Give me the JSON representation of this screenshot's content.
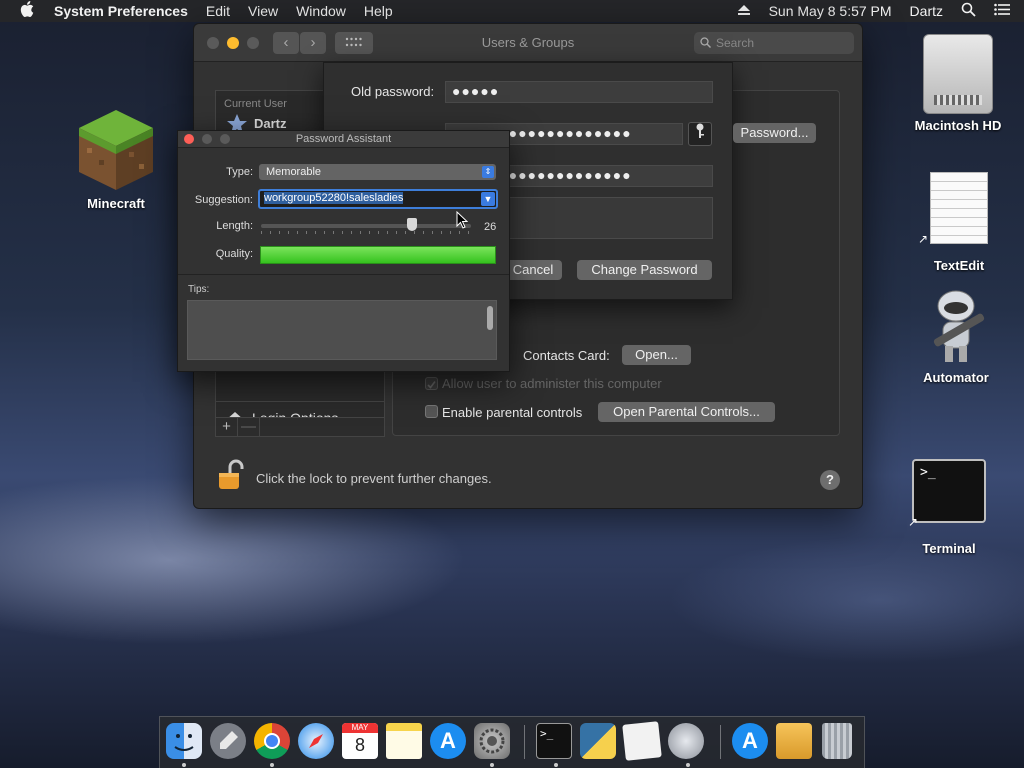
{
  "menubar": {
    "app_name": "System Preferences",
    "items": [
      "Edit",
      "View",
      "Window",
      "Help"
    ],
    "clock": "Sun May 8  5:57 PM",
    "user": "Dartz"
  },
  "desktop": {
    "minecraft": "Minecraft",
    "macintosh_hd": "Macintosh HD",
    "textedit": "TextEdit",
    "automator": "Automator",
    "terminal": "Terminal"
  },
  "window": {
    "title": "Users & Groups",
    "search_placeholder": "Search",
    "current_user_header": "Current User",
    "current_user_name": "Dartz",
    "login_options": "Login Options",
    "add_symbol": "+",
    "remove_symbol": "—",
    "contacts_card_label": "Contacts Card:",
    "open_button": "Open...",
    "allow_admin_label": "Allow user to administer this computer",
    "parental_controls_label": "Enable parental controls",
    "open_parental_button": "Open Parental Controls...",
    "lock_text": "Click the lock to prevent further changes.",
    "help_symbol": "?"
  },
  "sheet": {
    "old_password_label": "Old password:",
    "old_password_value": "●●●●●",
    "new_password_value": "●●●●●●●●●●●●●●●●●●●",
    "verify_value": "●●●●●●●●●●●●●●●●●●●",
    "password_button": "Password...",
    "cancel_button": "Cancel",
    "change_button": "Change Password"
  },
  "assistant": {
    "title": "Password Assistant",
    "type_label": "Type:",
    "type_value": "Memorable",
    "suggestion_label": "Suggestion:",
    "suggestion_value": "workgroup52280!salesladies",
    "length_label": "Length:",
    "length_value": "26",
    "length_fraction": 0.72,
    "quality_label": "Quality:",
    "quality_fraction": 1.0,
    "tips_label": "Tips:"
  },
  "dock": {
    "apps": [
      "finder-icon",
      "launchpad-icon",
      "chrome-icon",
      "safari-icon",
      "calendar-icon",
      "notes-icon",
      "app-store-icon",
      "system-preferences-icon",
      "terminal-icon",
      "python-launcher-icon",
      "script-editor-icon",
      "automator-icon",
      "app-store-folder-icon",
      "package-icon",
      "trash-icon"
    ],
    "calendar_month": "MAY",
    "calendar_day": "8"
  },
  "colors": {
    "accent": "#3a7be0",
    "quality_green": "#35c21e",
    "close_red": "#fe5f57",
    "minimize_yellow": "#febc2e"
  }
}
